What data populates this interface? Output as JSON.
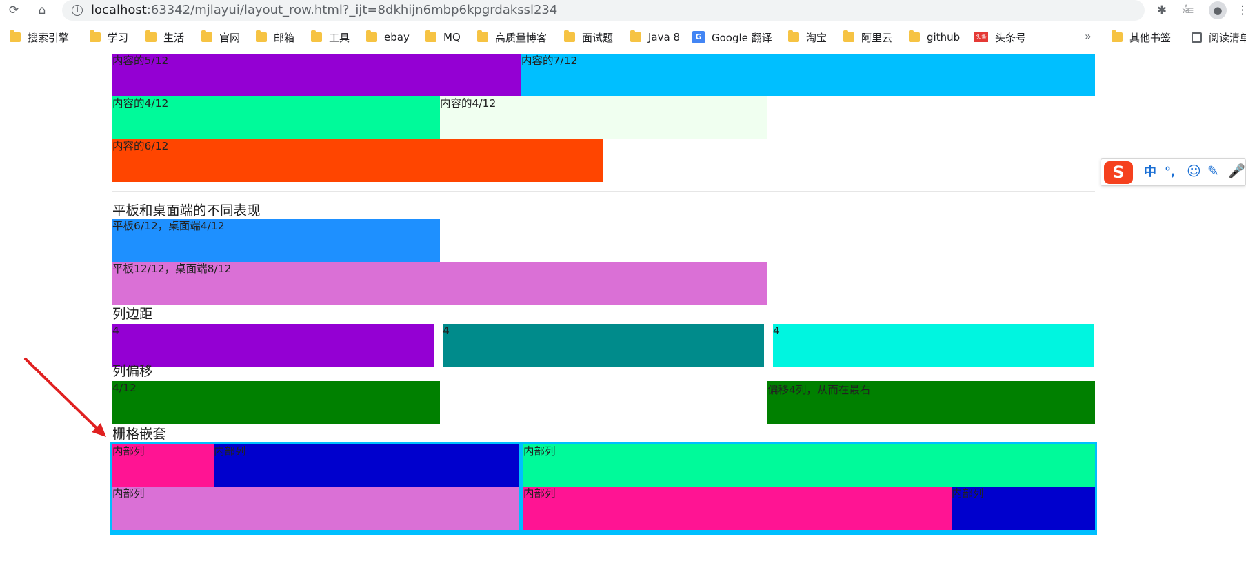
{
  "browser": {
    "url_host": "localhost",
    "url_path": ":63342/mjlayui/layout_row.html?_ijt=8dkhijn6mbp6kpgrdakssl234",
    "reload_icon": "reload-icon",
    "home_icon": "home-icon",
    "star_icon": "star-icon",
    "bookmarks": [
      "搜索引擎",
      "学习",
      "生活",
      "官网",
      "邮箱",
      "工具",
      "ebay",
      "MQ",
      "高质量博客",
      "面试题",
      "Java 8",
      "Google 翻译",
      "淘宝",
      "阿里云",
      "github",
      "头条号"
    ],
    "toutiao_badge": "头条",
    "more_label": "»",
    "other_bookmarks": "其他书签",
    "reading_list": "阅读清单"
  },
  "sections": {
    "tablet_desktop": "平板和桌面端的不同表现",
    "col_space": "列边距",
    "col_offset": "列偏移",
    "nesting": "栅格嵌套"
  },
  "blocks": [
    {
      "text": "内容的5/12",
      "color": "#9400d3"
    },
    {
      "text": "内容的7/12",
      "color": "#00bfff"
    },
    {
      "text": "内容的4/12",
      "color": "#00fa9a"
    },
    {
      "text": "内容的4/12",
      "color": "#f0fff0"
    },
    {
      "text": "内容的6/12",
      "color": "#ff4500"
    },
    {
      "text": "平板6/12，桌面端4/12",
      "color": "#1e90ff"
    },
    {
      "text": "平板12/12，桌面端8/12",
      "color": "#da70d6"
    },
    {
      "text": "4",
      "color": "#9400d3"
    },
    {
      "text": "4",
      "color": "#008b8b"
    },
    {
      "text": "4",
      "color": "#00f5e0"
    },
    {
      "text": "4/12",
      "color": "#008000"
    },
    {
      "text": "偏移4列，从而在最右",
      "color": "#008000"
    },
    {
      "text": "内部列",
      "color": "#ff1493"
    },
    {
      "text": "内部列",
      "color": "#0000cd"
    },
    {
      "text": "内部列",
      "color": "#00fa9a"
    },
    {
      "text": "内部列",
      "color": "#da70d6"
    },
    {
      "text": "内部列",
      "color": "#ff1493"
    },
    {
      "text": "内部列",
      "color": "#0000cd"
    }
  ],
  "nest_frame_color": "#00bfff",
  "arrow_color": "#e02020",
  "ime": {
    "logo": "S",
    "lang": "中",
    "punct": "°,",
    "emoji_icon": "smiley-icon",
    "pen_icon": "pen-icon",
    "mic_icon": "microphone-icon"
  }
}
